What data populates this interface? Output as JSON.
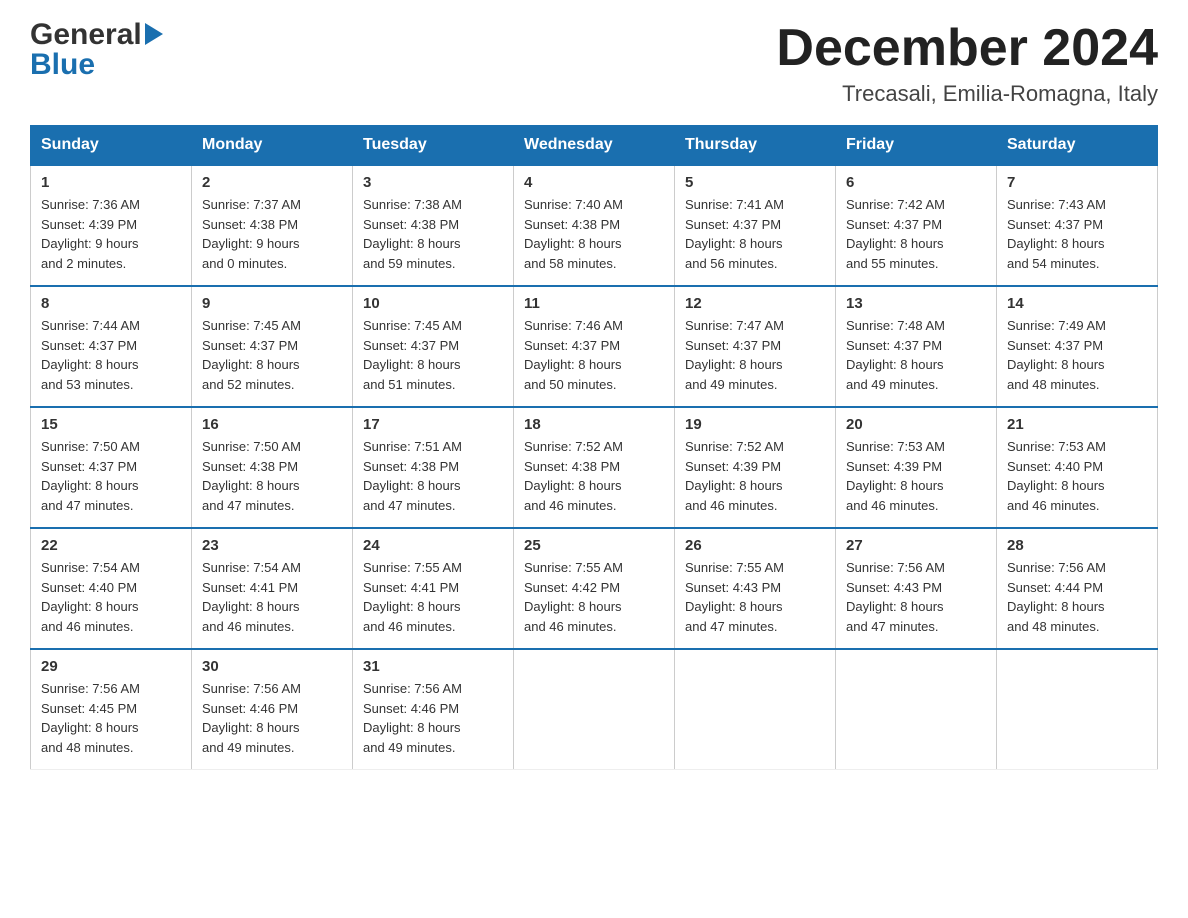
{
  "logo": {
    "general": "General",
    "blue": "Blue"
  },
  "header": {
    "month_year": "December 2024",
    "location": "Trecasali, Emilia-Romagna, Italy"
  },
  "days_of_week": [
    "Sunday",
    "Monday",
    "Tuesday",
    "Wednesday",
    "Thursday",
    "Friday",
    "Saturday"
  ],
  "weeks": [
    [
      {
        "day": "1",
        "sunrise": "7:36 AM",
        "sunset": "4:39 PM",
        "daylight": "9 hours and 2 minutes."
      },
      {
        "day": "2",
        "sunrise": "7:37 AM",
        "sunset": "4:38 PM",
        "daylight": "9 hours and 0 minutes."
      },
      {
        "day": "3",
        "sunrise": "7:38 AM",
        "sunset": "4:38 PM",
        "daylight": "8 hours and 59 minutes."
      },
      {
        "day": "4",
        "sunrise": "7:40 AM",
        "sunset": "4:38 PM",
        "daylight": "8 hours and 58 minutes."
      },
      {
        "day": "5",
        "sunrise": "7:41 AM",
        "sunset": "4:37 PM",
        "daylight": "8 hours and 56 minutes."
      },
      {
        "day": "6",
        "sunrise": "7:42 AM",
        "sunset": "4:37 PM",
        "daylight": "8 hours and 55 minutes."
      },
      {
        "day": "7",
        "sunrise": "7:43 AM",
        "sunset": "4:37 PM",
        "daylight": "8 hours and 54 minutes."
      }
    ],
    [
      {
        "day": "8",
        "sunrise": "7:44 AM",
        "sunset": "4:37 PM",
        "daylight": "8 hours and 53 minutes."
      },
      {
        "day": "9",
        "sunrise": "7:45 AM",
        "sunset": "4:37 PM",
        "daylight": "8 hours and 52 minutes."
      },
      {
        "day": "10",
        "sunrise": "7:45 AM",
        "sunset": "4:37 PM",
        "daylight": "8 hours and 51 minutes."
      },
      {
        "day": "11",
        "sunrise": "7:46 AM",
        "sunset": "4:37 PM",
        "daylight": "8 hours and 50 minutes."
      },
      {
        "day": "12",
        "sunrise": "7:47 AM",
        "sunset": "4:37 PM",
        "daylight": "8 hours and 49 minutes."
      },
      {
        "day": "13",
        "sunrise": "7:48 AM",
        "sunset": "4:37 PM",
        "daylight": "8 hours and 49 minutes."
      },
      {
        "day": "14",
        "sunrise": "7:49 AM",
        "sunset": "4:37 PM",
        "daylight": "8 hours and 48 minutes."
      }
    ],
    [
      {
        "day": "15",
        "sunrise": "7:50 AM",
        "sunset": "4:37 PM",
        "daylight": "8 hours and 47 minutes."
      },
      {
        "day": "16",
        "sunrise": "7:50 AM",
        "sunset": "4:38 PM",
        "daylight": "8 hours and 47 minutes."
      },
      {
        "day": "17",
        "sunrise": "7:51 AM",
        "sunset": "4:38 PM",
        "daylight": "8 hours and 47 minutes."
      },
      {
        "day": "18",
        "sunrise": "7:52 AM",
        "sunset": "4:38 PM",
        "daylight": "8 hours and 46 minutes."
      },
      {
        "day": "19",
        "sunrise": "7:52 AM",
        "sunset": "4:39 PM",
        "daylight": "8 hours and 46 minutes."
      },
      {
        "day": "20",
        "sunrise": "7:53 AM",
        "sunset": "4:39 PM",
        "daylight": "8 hours and 46 minutes."
      },
      {
        "day": "21",
        "sunrise": "7:53 AM",
        "sunset": "4:40 PM",
        "daylight": "8 hours and 46 minutes."
      }
    ],
    [
      {
        "day": "22",
        "sunrise": "7:54 AM",
        "sunset": "4:40 PM",
        "daylight": "8 hours and 46 minutes."
      },
      {
        "day": "23",
        "sunrise": "7:54 AM",
        "sunset": "4:41 PM",
        "daylight": "8 hours and 46 minutes."
      },
      {
        "day": "24",
        "sunrise": "7:55 AM",
        "sunset": "4:41 PM",
        "daylight": "8 hours and 46 minutes."
      },
      {
        "day": "25",
        "sunrise": "7:55 AM",
        "sunset": "4:42 PM",
        "daylight": "8 hours and 46 minutes."
      },
      {
        "day": "26",
        "sunrise": "7:55 AM",
        "sunset": "4:43 PM",
        "daylight": "8 hours and 47 minutes."
      },
      {
        "day": "27",
        "sunrise": "7:56 AM",
        "sunset": "4:43 PM",
        "daylight": "8 hours and 47 minutes."
      },
      {
        "day": "28",
        "sunrise": "7:56 AM",
        "sunset": "4:44 PM",
        "daylight": "8 hours and 48 minutes."
      }
    ],
    [
      {
        "day": "29",
        "sunrise": "7:56 AM",
        "sunset": "4:45 PM",
        "daylight": "8 hours and 48 minutes."
      },
      {
        "day": "30",
        "sunrise": "7:56 AM",
        "sunset": "4:46 PM",
        "daylight": "8 hours and 49 minutes."
      },
      {
        "day": "31",
        "sunrise": "7:56 AM",
        "sunset": "4:46 PM",
        "daylight": "8 hours and 49 minutes."
      },
      null,
      null,
      null,
      null
    ]
  ]
}
